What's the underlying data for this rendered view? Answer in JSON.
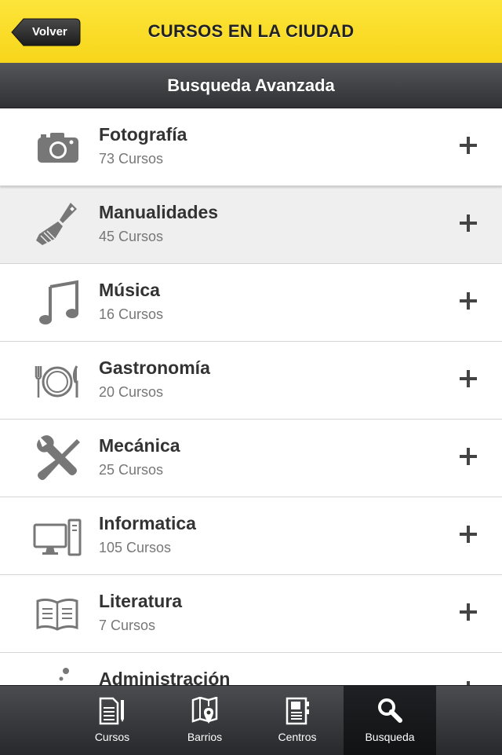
{
  "header": {
    "back_label": "Volver",
    "title": "CURSOS EN LA CIUDAD"
  },
  "subheader": {
    "title": "Busqueda Avanzada"
  },
  "categories": [
    {
      "name": "Fotografía",
      "count": "73 Cursos",
      "icon": "camera-icon"
    },
    {
      "name": "Manualidades",
      "count": "45 Cursos",
      "icon": "paintbrush-icon",
      "selected": true
    },
    {
      "name": "Música",
      "count": "16 Cursos",
      "icon": "music-note-icon"
    },
    {
      "name": "Gastronomía",
      "count": "20 Cursos",
      "icon": "plate-cutlery-icon"
    },
    {
      "name": "Mecánica",
      "count": "25 Cursos",
      "icon": "wrench-screwdriver-icon"
    },
    {
      "name": "Informatica",
      "count": "105 Cursos",
      "icon": "computer-icon"
    },
    {
      "name": "Literatura",
      "count": "7 Cursos",
      "icon": "open-book-icon"
    },
    {
      "name": "Administración",
      "count": "",
      "icon": "dots-icon"
    }
  ],
  "tabbar": {
    "tabs": [
      {
        "label": "Cursos",
        "icon": "document-pencil-icon"
      },
      {
        "label": "Barrios",
        "icon": "map-pin-icon"
      },
      {
        "label": "Centros",
        "icon": "address-book-icon"
      },
      {
        "label": "Busqueda",
        "icon": "search-icon",
        "active": true
      }
    ]
  },
  "colors": {
    "accent_yellow": "#fde53a",
    "dark_bar": "#3a3c3f",
    "icon_gray": "#777777"
  }
}
